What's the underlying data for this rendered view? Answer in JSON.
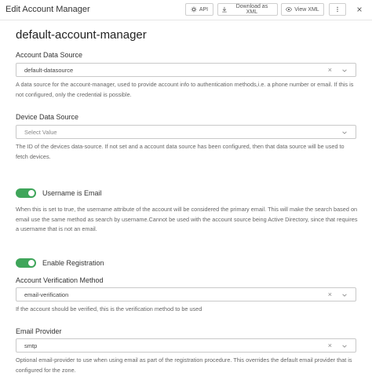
{
  "header": {
    "title": "Edit Account Manager",
    "api_label": "API",
    "download_label": "Download as XML",
    "view_label": "View XML"
  },
  "page_title": "default-account-manager",
  "account_data_source": {
    "label": "Account Data Source",
    "value": "default-datasource",
    "help": "A data source for the account-manager, used to provide account info to authentication methods,i.e. a phone number or email. If this is not configured, only the credential is possible."
  },
  "device_data_source": {
    "label": "Device Data Source",
    "placeholder": "Select Value",
    "help": "The ID of the devices data-source. If not set and a account data source has been configured, then that data source will be used to fetch devices."
  },
  "username_is_email": {
    "label": "Username is Email",
    "enabled": true,
    "help": "When this is set to true, the username attribute of the account will be considered the primary email. This will make the search based on email use the same method as search by username.Cannot be used with the account source being Active Directory, since that requires a username that is not an email."
  },
  "enable_registration": {
    "label": "Enable Registration",
    "enabled": true
  },
  "account_verification_method": {
    "label": "Account Verification Method",
    "value": "email-verification",
    "help": "If the account should be verified, this is the verification method to be used"
  },
  "email_provider": {
    "label": "Email Provider",
    "value": "smtp",
    "help": "Optional email-provider to use when using email as part of the registration procedure. This overrides the default email provider that is configured for the zone."
  },
  "icons": {
    "clear": "×",
    "chevron": "chevron-down-icon"
  },
  "colors": {
    "toggle_on": "#3fa55a"
  }
}
